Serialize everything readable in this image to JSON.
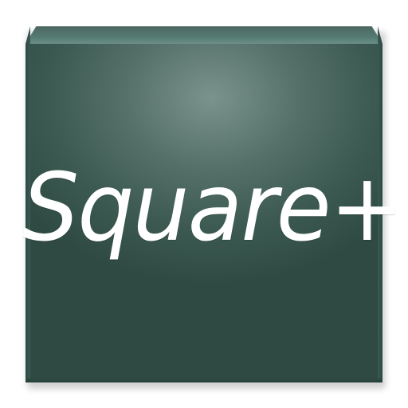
{
  "app_icon": {
    "title": "Square+",
    "colors": {
      "board": "#3c5a52",
      "board_highlight": "#7a948d",
      "text": "#ffffff"
    }
  }
}
